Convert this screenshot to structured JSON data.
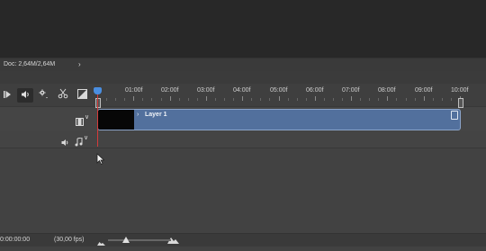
{
  "status": {
    "doc_info": "Doc: 2,64M/2,64M",
    "menu_arrow": "›"
  },
  "controls": {
    "play_icon": "play-icon",
    "audio_icon": "speaker-icon",
    "settings_icon": "gear-icon",
    "split_icon": "scissors-icon",
    "transition_icon": "transition-icon"
  },
  "ruler": {
    "labels": [
      "01:00f",
      "02:00f",
      "03:00f",
      "04:00f",
      "05:00f",
      "06:00f",
      "07:00f",
      "08:00f",
      "09:00f",
      "10:00f"
    ]
  },
  "tracks": {
    "layer": {
      "name": "Layer 1",
      "chevron": "›",
      "menu_chevron": "∨"
    },
    "audio": {
      "menu_chevron": "∨"
    }
  },
  "bottom": {
    "timecode": "0:00:00:00",
    "fps": "(30,00 fps)"
  }
}
